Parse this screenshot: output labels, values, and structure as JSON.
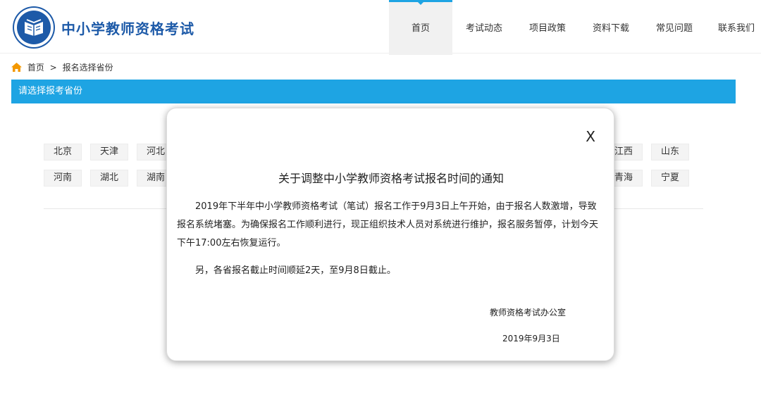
{
  "site": {
    "title": "中小学教师资格考试"
  },
  "nav": {
    "items": [
      {
        "label": "首页",
        "active": true
      },
      {
        "label": "考试动态"
      },
      {
        "label": "项目政策"
      },
      {
        "label": "资料下载"
      },
      {
        "label": "常见问题"
      },
      {
        "label": "联系我们"
      }
    ]
  },
  "breadcrumb": {
    "home": "首页",
    "separator": ">",
    "current": "报名选择省份"
  },
  "select_bar": {
    "title": "请选择报考省份"
  },
  "provinces": {
    "row1": [
      "北京",
      "天津",
      "河北",
      "江西",
      "山东"
    ],
    "row2": [
      "河南",
      "湖北",
      "湖南",
      "青海",
      "宁夏"
    ]
  },
  "modal": {
    "close": "X",
    "title": "关于调整中小学教师资格考试报名时间的通知",
    "paragraph1": "2019年下半年中小学教师资格考试（笔试）报名工作于9月3日上午开始，由于报名人数激增，导致报名系统堵塞。为确保报名工作顺利进行，现正组织技术人员对系统进行维护，报名服务暂停，计划今天下午17:00左右恢复运行。",
    "paragraph2": "另，各省报名截止时间顺延2天，至9月8日截止。",
    "signature": "教师资格考试办公室",
    "date": "2019年9月3日"
  },
  "colors": {
    "brand": "#1d5aa8",
    "accent": "#1ea4e3",
    "home_icon": "#f39800"
  }
}
